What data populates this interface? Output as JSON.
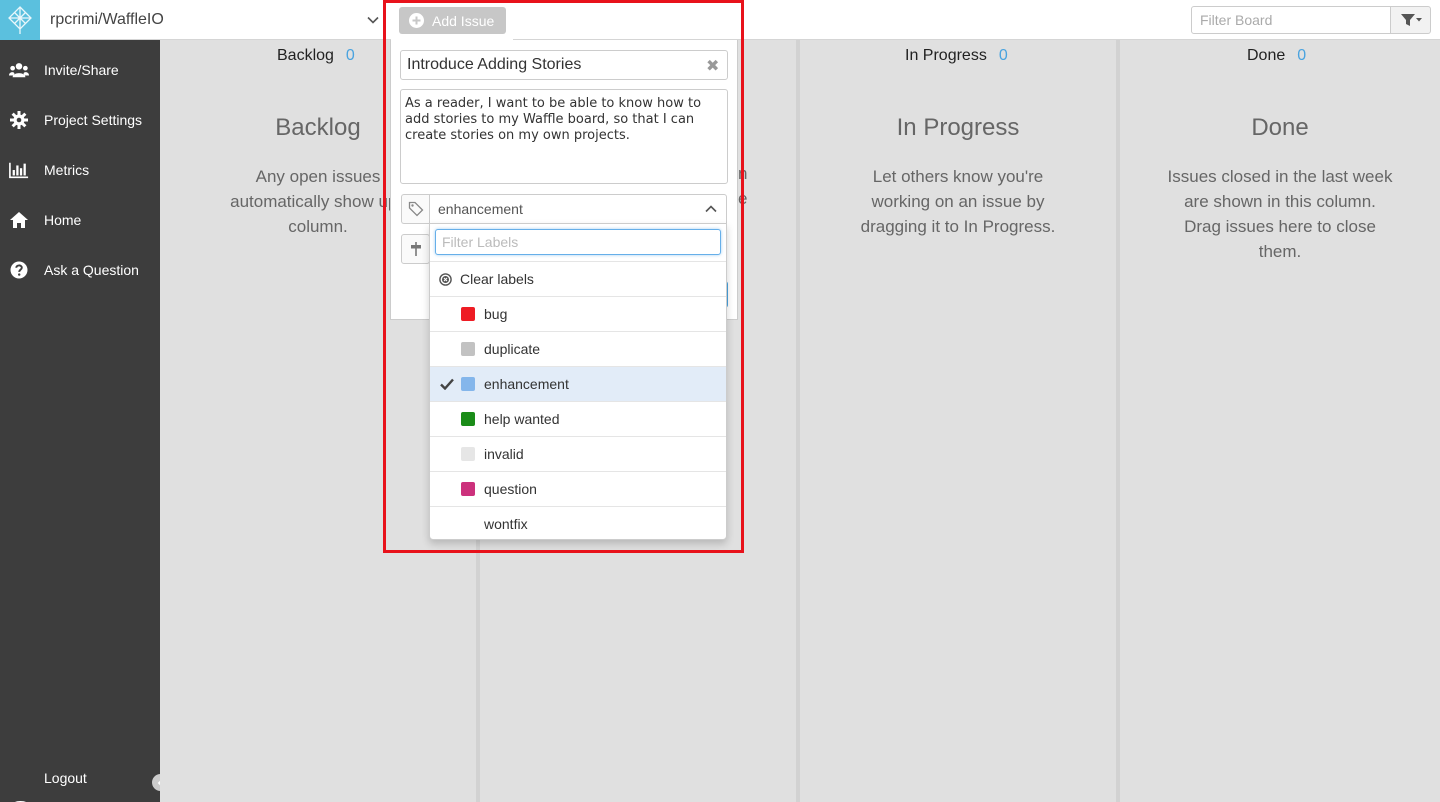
{
  "header": {
    "repo": "rpcrimi/WaffleIO",
    "filter_placeholder": "Filter Board"
  },
  "sidebar": {
    "items": [
      {
        "label": "Invite/Share",
        "icon": "users-icon"
      },
      {
        "label": "Project Settings",
        "icon": "gear-icon"
      },
      {
        "label": "Metrics",
        "icon": "bar-chart-icon"
      },
      {
        "label": "Home",
        "icon": "home-icon"
      },
      {
        "label": "Ask a Question",
        "icon": "question-icon"
      }
    ],
    "logout": "Logout"
  },
  "columns": [
    {
      "name": "Backlog",
      "count": "0",
      "title": "Backlog",
      "desc": [
        "Any open issues",
        "automatically show up i",
        "column."
      ]
    },
    {
      "name": "In Progress",
      "count": "0",
      "title": "In Progress",
      "desc": [
        "Let others know you're",
        "working on an issue by",
        "dragging it to In Progress."
      ]
    },
    {
      "name": "Done",
      "count": "0",
      "title": "Done",
      "desc": [
        "Issues closed in the last week",
        "are shown in this column.",
        "Drag issues here to close",
        "them."
      ]
    }
  ],
  "hidden_column_fragments": [
    "n",
    "e"
  ],
  "add_issue": {
    "button_label": "Add Issue",
    "title_value": "Introduce Adding Stories",
    "clear_symbol": "✖",
    "body_value": "As a reader, I want to be able to know how to add stories to my Waffle board, so that I can create stories on my own projects.",
    "selected_label": "enhancement"
  },
  "label_dropdown": {
    "filter_placeholder": "Filter Labels",
    "clear_label": "Clear labels",
    "labels": [
      {
        "name": "bug",
        "color": "#ee1c24",
        "selected": false
      },
      {
        "name": "duplicate",
        "color": "#c2c2c2",
        "selected": false
      },
      {
        "name": "enhancement",
        "color": "#84b6eb",
        "selected": true
      },
      {
        "name": "help wanted",
        "color": "#1a8c18",
        "selected": false
      },
      {
        "name": "invalid",
        "color": "#e6e6e6",
        "selected": false
      },
      {
        "name": "question",
        "color": "#cc317c",
        "selected": false
      },
      {
        "name": "wontfix",
        "color": "",
        "selected": false
      }
    ]
  },
  "colors": {
    "sidebar_bg": "#3d3d3d",
    "accent": "#4aa3df",
    "highlight_border": "#e8121b"
  }
}
